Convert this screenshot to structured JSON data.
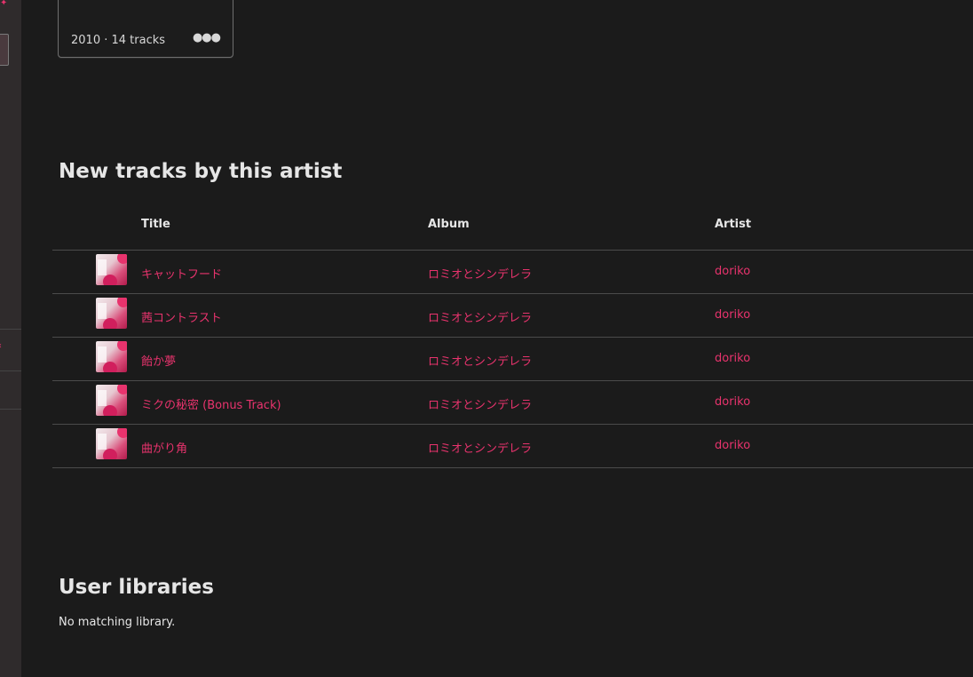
{
  "album_card": {
    "year": "2010",
    "track_count": "· 14 tracks",
    "more_label": "●●●"
  },
  "tracks_section": {
    "title": "New tracks by this artist",
    "columns": {
      "title": "Title",
      "album": "Album",
      "artist": "Artist"
    },
    "rows": [
      {
        "title": "キャットフード",
        "album": "ロミオとシンデレラ",
        "artist": "doriko"
      },
      {
        "title": "茜コントラスト",
        "album": "ロミオとシンデレラ",
        "artist": "doriko"
      },
      {
        "title": "飴か夢",
        "album": "ロミオとシンデレラ",
        "artist": "doriko"
      },
      {
        "title": "ミクの秘密 (Bonus Track)",
        "album": "ロミオとシンデレラ",
        "artist": "doriko"
      },
      {
        "title": "曲がり角",
        "album": "ロミオとシンデレラ",
        "artist": "doriko"
      }
    ]
  },
  "libraries_section": {
    "title": "User libraries",
    "empty_text": "No matching library."
  },
  "colors": {
    "accent": "#e8336d",
    "background": "#1b1b1b",
    "sidebar": "#2f2b2c"
  }
}
